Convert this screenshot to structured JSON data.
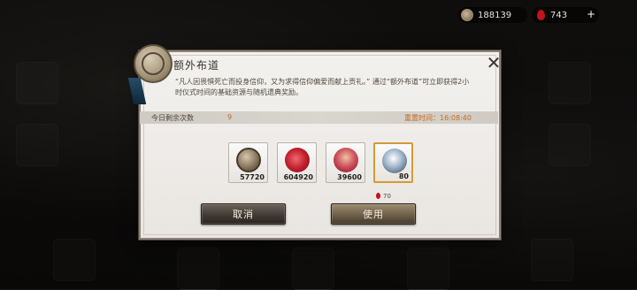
{
  "currencies": {
    "coins": {
      "icon": "coin-icon",
      "value": "188139"
    },
    "blood": {
      "icon": "blood-drop-icon",
      "value": "743",
      "add_label": "+"
    }
  },
  "dialog": {
    "title": "额外布道",
    "description": "“凡人因畏惧死亡而投身信仰，又为求得信仰偏爱而献上贡礼。” 通过“额外布道”可立即获得2小时仪式时间的基础资源与随机遗典奖励。",
    "remaining_label": "今日剩余次数",
    "remaining_value": "9",
    "reset_text": "重置时间：16:08:40",
    "close_icon": "close-icon",
    "items": [
      {
        "icon": "coin-icon",
        "quantity": "57720",
        "selected": false
      },
      {
        "icon": "rose-icon",
        "quantity": "604920",
        "selected": false
      },
      {
        "icon": "helmet-icon",
        "quantity": "39600",
        "selected": false
      },
      {
        "icon": "crystal-icon",
        "quantity": "80",
        "selected": true
      }
    ],
    "cost": "70",
    "cancel_label": "取消",
    "use_label": "使用"
  },
  "colors": {
    "accent": "#c36b22",
    "blood": "#c2121e",
    "selected_border": "#d59a36"
  }
}
